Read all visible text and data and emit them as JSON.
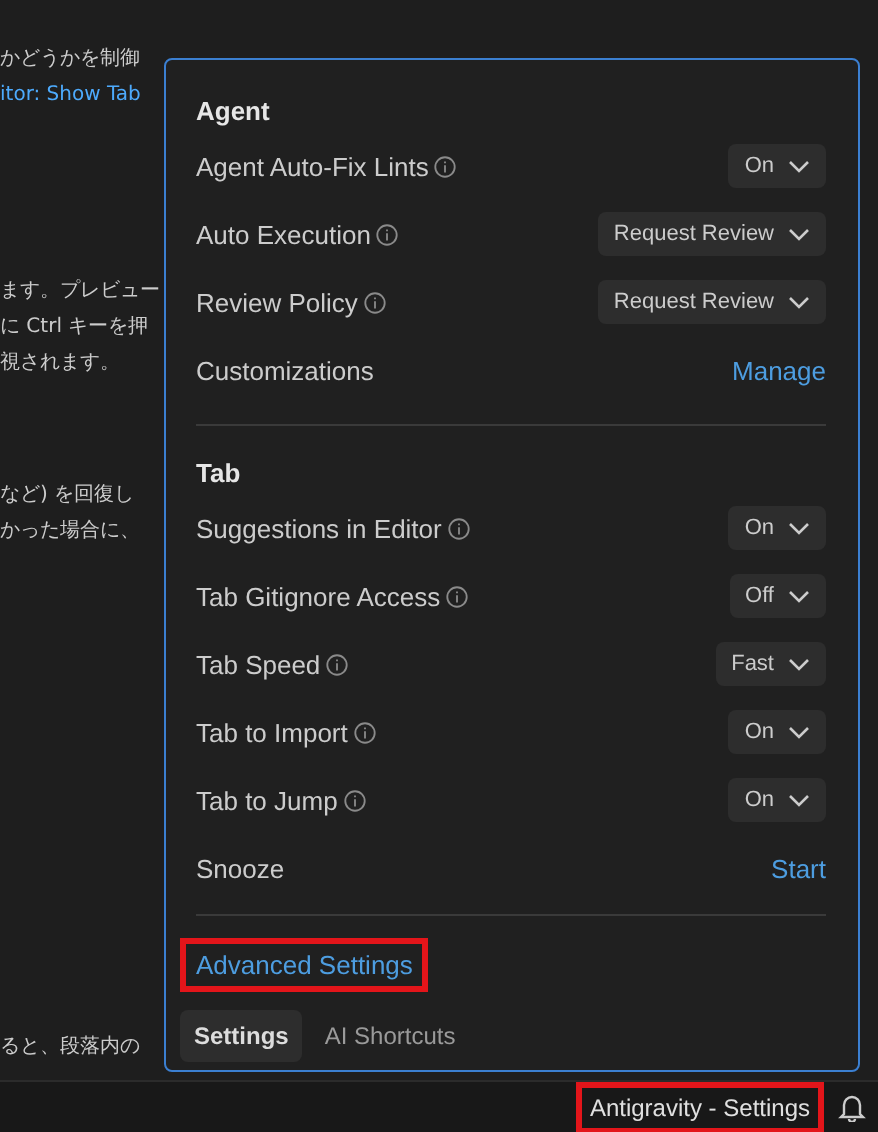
{
  "editor": {
    "paragraphs": [
      {
        "lines": [
          {
            "text": "かどうかを制御",
            "kind": "text"
          },
          {
            "text": "itor: Show Tab",
            "kind": "link"
          }
        ]
      },
      {
        "lines": [
          {
            "text": "ます。プレビュー",
            "kind": "text"
          },
          {
            "text": "に Ctrl キーを押",
            "kind": "text"
          },
          {
            "text": "視されます。",
            "kind": "text"
          }
        ]
      },
      {
        "lines": [
          {
            "text": "など) を回復し",
            "kind": "text"
          },
          {
            "text": "かった場合に、",
            "kind": "text"
          }
        ]
      },
      {
        "lines": [
          {
            "text": "ると、段落内の",
            "kind": "text"
          }
        ]
      }
    ]
  },
  "popup": {
    "sections": [
      {
        "title": "Agent",
        "rows": [
          {
            "label": "Agent Auto-Fix Lints",
            "info": true,
            "kind": "dropdown",
            "value": "On"
          },
          {
            "label": "Auto Execution",
            "info": true,
            "kind": "dropdown",
            "value": "Request Review"
          },
          {
            "label": "Review Policy",
            "info": true,
            "kind": "dropdown",
            "value": "Request Review"
          },
          {
            "label": "Customizations",
            "info": false,
            "kind": "link",
            "value": "Manage"
          }
        ]
      },
      {
        "title": "Tab",
        "rows": [
          {
            "label": "Suggestions in Editor",
            "info": true,
            "kind": "dropdown",
            "value": "On"
          },
          {
            "label": "Tab Gitignore Access",
            "info": true,
            "kind": "dropdown",
            "value": "Off"
          },
          {
            "label": "Tab Speed",
            "info": true,
            "kind": "dropdown",
            "value": "Fast"
          },
          {
            "label": "Tab to Import",
            "info": true,
            "kind": "dropdown",
            "value": "On"
          },
          {
            "label": "Tab to Jump",
            "info": true,
            "kind": "dropdown",
            "value": "On"
          },
          {
            "label": "Snooze",
            "info": false,
            "kind": "link",
            "value": "Start"
          }
        ]
      }
    ],
    "advanced_link": {
      "label": "Advanced Settings",
      "highlighted": true
    },
    "tabs": [
      {
        "label": "Settings",
        "selected": true
      },
      {
        "label": "AI Shortcuts",
        "selected": false
      }
    ]
  },
  "status_bar": {
    "item": {
      "label": "Antigravity - Settings",
      "highlighted": true
    }
  }
}
